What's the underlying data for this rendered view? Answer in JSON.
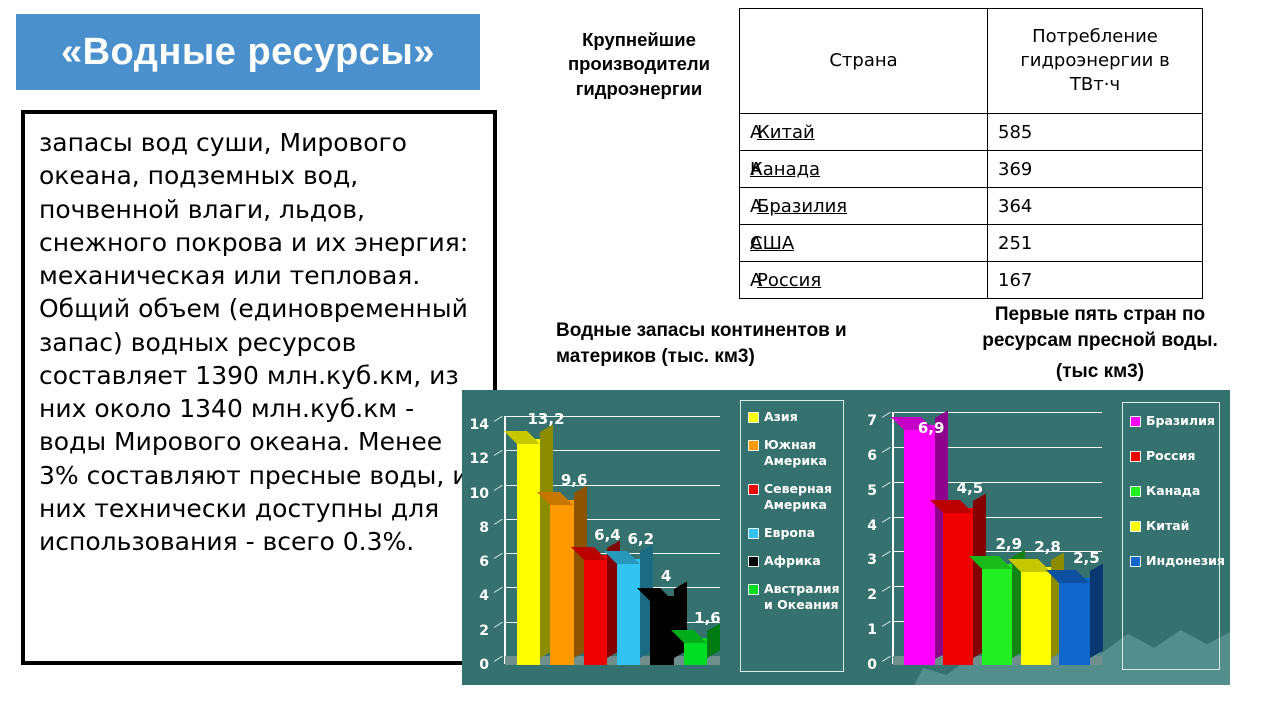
{
  "title": "«Водные ресурсы»",
  "info_text": "запасы вод суши, Мирового океана, подземных вод, почвенной влаги, льдов, снежного покрова и их энергия: механическая или тепловая. Общий объем (единовременный запас) водных ресурсов составляет 1390 млн.куб.км, из них около 1340 млн.куб.км - воды Мирового океана. Менее 3% составляют пресные воды, из них технически доступны для использования - всего 0.3%.",
  "hydro": {
    "caption": "Крупнейшие производители гидроэнергии",
    "columns": [
      "Страна",
      "Потребление гидроэнергии в ТВт·ч"
    ],
    "rows": [
      {
        "country": "Китай",
        "value": "585"
      },
      {
        "country": "Канада",
        "value": "369"
      },
      {
        "country": "Бразилия",
        "value": "364"
      },
      {
        "country": "США",
        "value": "251"
      },
      {
        "country": "Россия",
        "value": "167"
      }
    ]
  },
  "chart1_caption": "Водные запасы континентов и материков (тыс. км3)",
  "chart2_caption": "Первые пять стран по ресурсам пресной воды.",
  "chart2_unit": "(тыс км3)",
  "colors": {
    "banner": "#4a90cd",
    "panel": "#35716f",
    "wave": "#5d9795"
  },
  "chart_data": [
    {
      "type": "bar",
      "title": "Водные запасы континентов и материков (тыс. км3)",
      "xlabel": "",
      "ylabel": "",
      "ylim": [
        0,
        14
      ],
      "yticks": [
        "0",
        "2",
        "4",
        "6",
        "8",
        "10",
        "12",
        "14"
      ],
      "grid": true,
      "legend_position": "right",
      "categories": [
        "Азия",
        "Южная Америка",
        "Северная Америка",
        "Европа",
        "Африка",
        "Австралия и Океания"
      ],
      "values": [
        13.2,
        9.6,
        6.4,
        6.2,
        4,
        1.6
      ],
      "value_labels": [
        "13,2",
        "9,6",
        "6,4",
        "6,2",
        "4",
        "1,6"
      ],
      "colors": [
        "#ffff00",
        "#ff9900",
        "#ee0000",
        "#33c3f0",
        "#000000",
        "#00dd22"
      ]
    },
    {
      "type": "bar",
      "title": "Первые пять стран по ресурсам пресной воды. (тыс км3)",
      "xlabel": "",
      "ylabel": "",
      "ylim": [
        0,
        7
      ],
      "yticks": [
        "0",
        "1",
        "2",
        "3",
        "4",
        "5",
        "6",
        "7"
      ],
      "grid": true,
      "legend_position": "right",
      "categories": [
        "Бразилия",
        "Россия",
        "Канада",
        "Китай",
        "Индонезия"
      ],
      "values": [
        6.9,
        4.5,
        2.9,
        2.8,
        2.5
      ],
      "value_labels": [
        "6,9",
        "4,5",
        "2,9",
        "2,8",
        "2,5"
      ],
      "colors": [
        "#ff00ff",
        "#ee0000",
        "#22ee22",
        "#ffff00",
        "#1166cc"
      ]
    }
  ]
}
